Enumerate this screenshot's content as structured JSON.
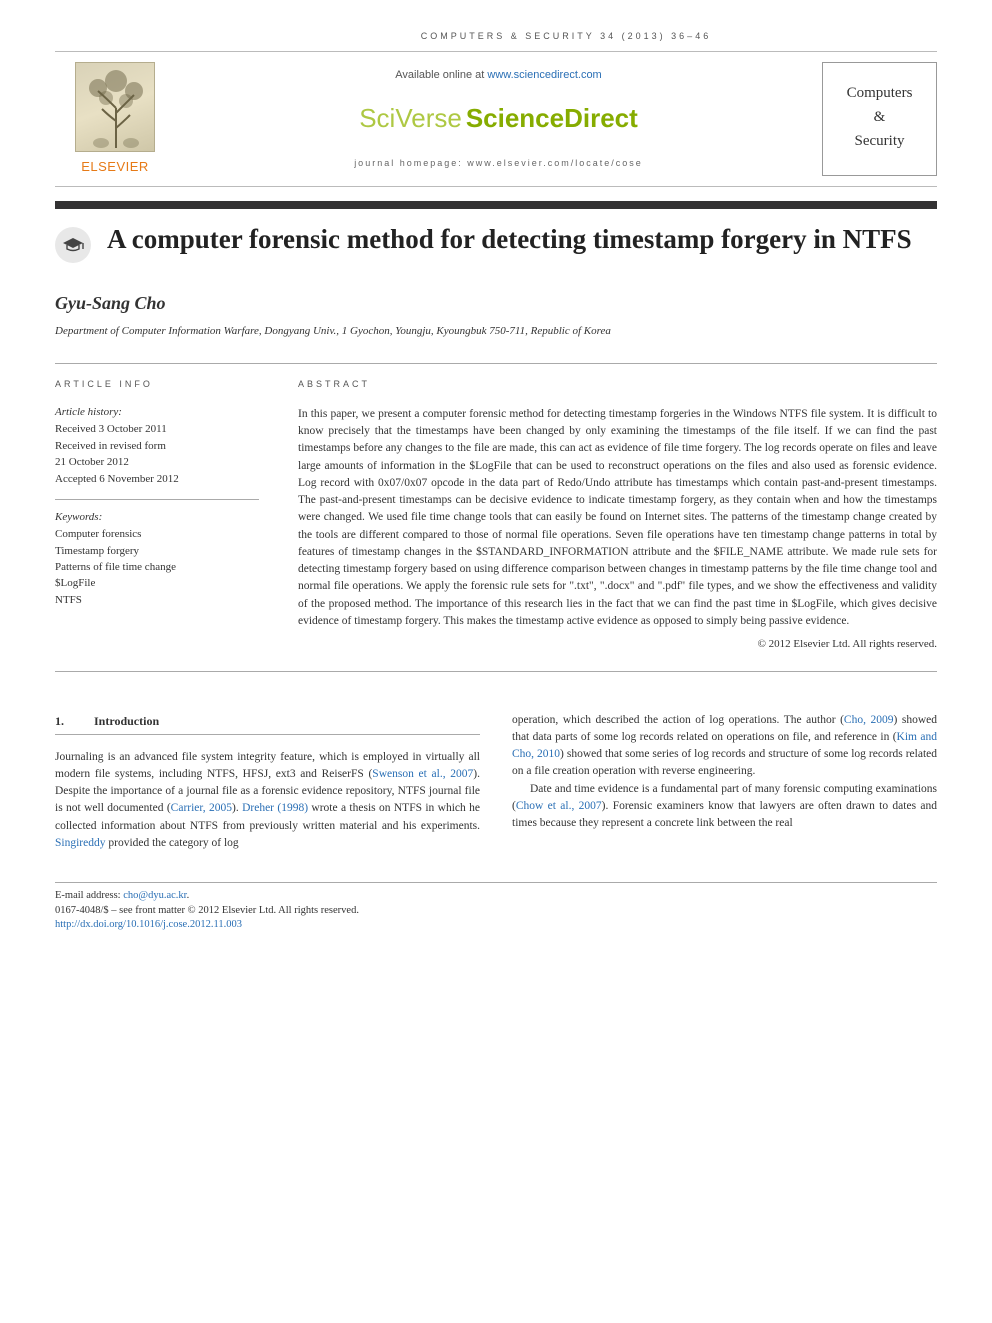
{
  "journal_ref": "COMPUTERS & SECURITY 34 (2013) 36–46",
  "header": {
    "available_prefix": "Available online at ",
    "available_link": "www.sciencedirect.com",
    "sciverse_sv": "SciVerse",
    "sciverse_sd": "ScienceDirect",
    "homepage_prefix": "journal homepage: ",
    "homepage_url": "www.elsevier.com/locate/cose",
    "elsevier_word": "ELSEVIER",
    "cover_line1": "Computers",
    "cover_line2": "&",
    "cover_line3": "Security"
  },
  "title": "A computer forensic method for detecting timestamp forgery in NTFS",
  "author": "Gyu-Sang Cho",
  "affiliation": "Department of Computer Information Warfare, Dongyang Univ., 1 Gyochon, Youngju, Kyoungbuk 750-711, Republic of Korea",
  "article_info": {
    "head": "ARTICLE INFO",
    "history_label": "Article history:",
    "received": "Received 3 October 2011",
    "revised1": "Received in revised form",
    "revised2": "21 October 2012",
    "accepted": "Accepted 6 November 2012",
    "keywords_label": "Keywords:",
    "keywords": [
      "Computer forensics",
      "Timestamp forgery",
      "Patterns of file time change",
      "$LogFile",
      "NTFS"
    ]
  },
  "abstract": {
    "head": "ABSTRACT",
    "text": "In this paper, we present a computer forensic method for detecting timestamp forgeries in the Windows NTFS file system. It is difficult to know precisely that the timestamps have been changed by only examining the timestamps of the file itself. If we can find the past timestamps before any changes to the file are made, this can act as evidence of file time forgery. The log records operate on files and leave large amounts of information in the $LogFile that can be used to reconstruct operations on the files and also used as forensic evidence. Log record with 0x07/0x07 opcode in the data part of Redo/Undo attribute has timestamps which contain past-and-present timestamps. The past-and-present timestamps can be decisive evidence to indicate timestamp forgery, as they contain when and how the timestamps were changed. We used file time change tools that can easily be found on Internet sites. The patterns of the timestamp change created by the tools are different compared to those of normal file operations. Seven file operations have ten timestamp change patterns in total by features of timestamp changes in the $STANDARD_INFORMATION attribute and the $FILE_NAME attribute. We made rule sets for detecting timestamp forgery based on using difference comparison between changes in timestamp patterns by the file time change tool and normal file operations. We apply the forensic rule sets for \".txt\", \".docx\" and \".pdf\" file types, and we show the effectiveness and validity of the proposed method. The importance of this research lies in the fact that we can find the past time in $LogFile, which gives decisive evidence of timestamp forgery. This makes the timestamp active evidence as opposed to simply being passive evidence.",
    "copyright": "© 2012 Elsevier Ltd. All rights reserved."
  },
  "section": {
    "num": "1.",
    "title": "Introduction"
  },
  "body": {
    "col1_p1_a": "Journaling is an advanced file system integrity feature, which is employed in virtually all modern file systems, including NTFS, HFSJ, ext3 and ReiserFS (",
    "col1_cite1": "Swenson et al., 2007",
    "col1_p1_b": "). Despite the importance of a journal file as a forensic evidence repository, NTFS journal file is not well documented (",
    "col1_cite2": "Carrier, 2005",
    "col1_p1_c": "). ",
    "col1_cite3": "Dreher (1998)",
    "col1_p1_d": " wrote a thesis on NTFS in which he collected information about NTFS from previously written material and his experiments. ",
    "col1_cite4": "Singireddy",
    "col1_p1_e": " provided the category of log",
    "col2_p1_a": "operation, which described the action of log operations. The author (",
    "col2_cite1": "Cho, 2009",
    "col2_p1_b": ") showed that data parts of some log records related on operations on file, and reference in (",
    "col2_cite2": "Kim and Cho, 2010",
    "col2_p1_c": ") showed that some series of log records and structure of some log records related on a file creation operation with reverse engineering.",
    "col2_p2_a": "Date and time evidence is a fundamental part of many forensic computing examinations (",
    "col2_cite3": "Chow et al., 2007",
    "col2_p2_b": "). Forensic examiners know that lawyers are often drawn to dates and times because they represent a concrete link between the real"
  },
  "footer": {
    "email_label": "E-mail address: ",
    "email": "cho@dyu.ac.kr",
    "email_suffix": ".",
    "issn_line": "0167-4048/$ – see front matter © 2012 Elsevier Ltd. All rights reserved.",
    "doi": "http://dx.doi.org/10.1016/j.cose.2012.11.003"
  }
}
